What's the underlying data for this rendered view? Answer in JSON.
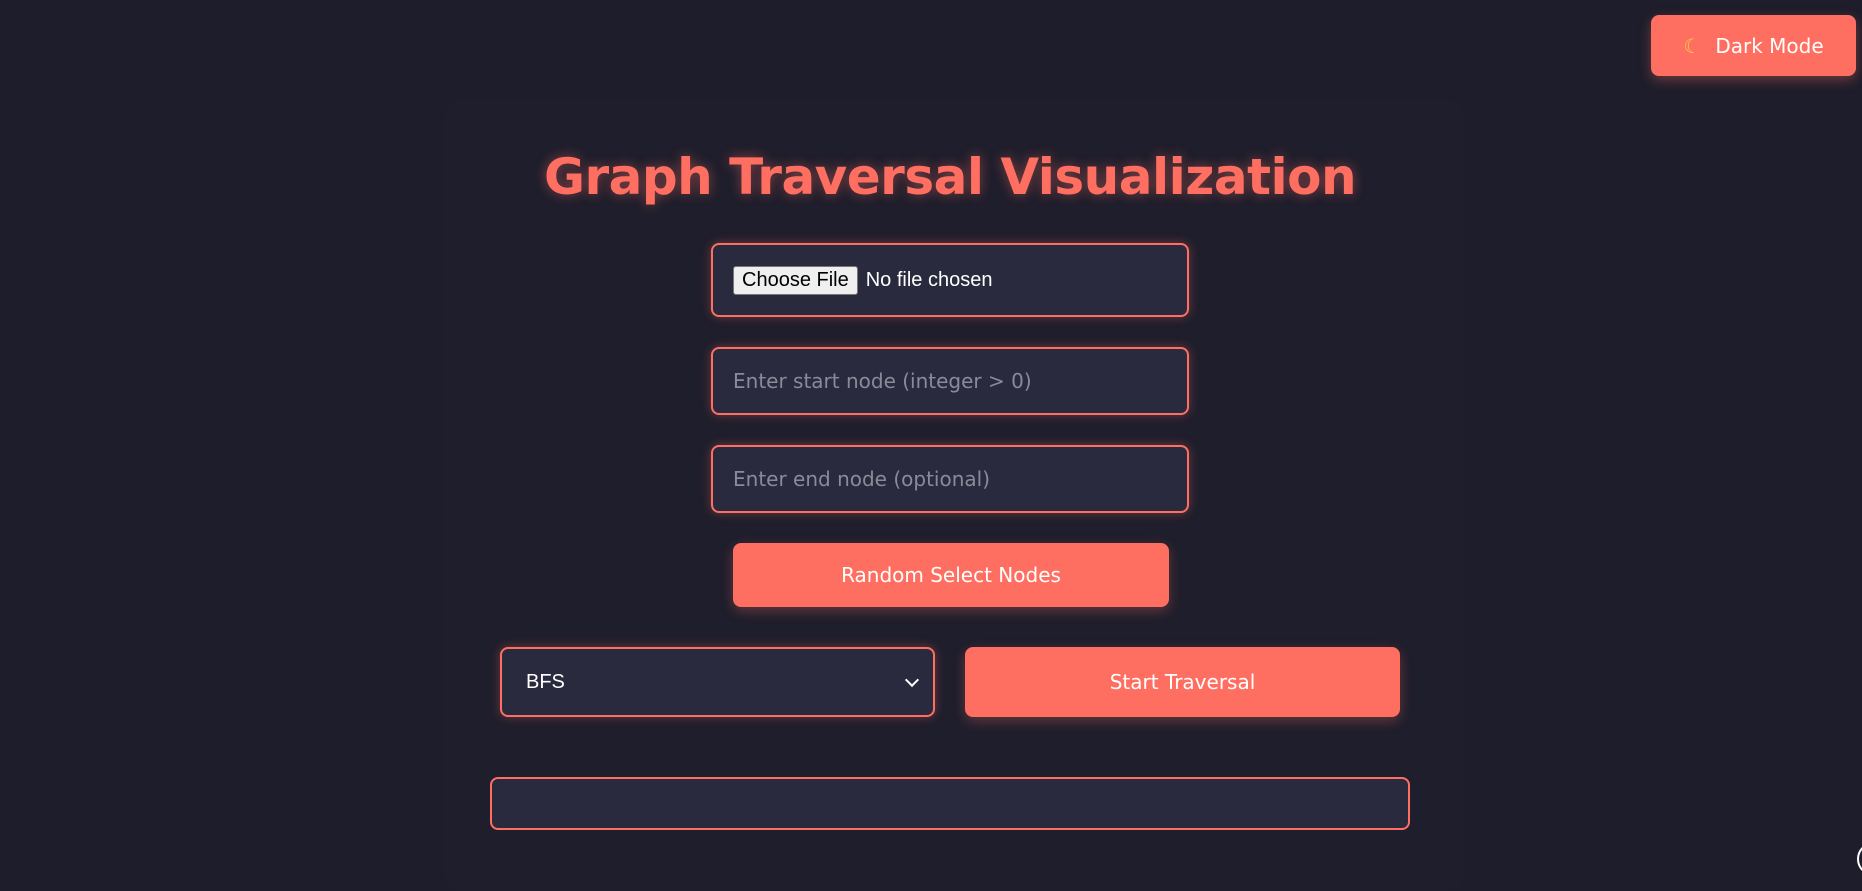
{
  "theme_toggle": {
    "icon": "crescent-moon-icon",
    "icon_glyph": "☾",
    "label": "Dark Mode"
  },
  "title": "Graph Traversal Visualization",
  "file_input": {
    "button_label": "Choose File",
    "status": "No file chosen"
  },
  "start_node": {
    "placeholder": "Enter start node (integer > 0)",
    "value": ""
  },
  "end_node": {
    "placeholder": "Enter end node (optional)",
    "value": ""
  },
  "random_button": {
    "label": "Random Select Nodes"
  },
  "algorithm_select": {
    "selected": "BFS"
  },
  "start_button": {
    "label": "Start Traversal"
  },
  "output": {
    "text": ""
  },
  "colors": {
    "background": "#1e1d2b",
    "accent": "#ff6f61",
    "field_bg": "#2a2a3f",
    "text": "#ffffff"
  }
}
